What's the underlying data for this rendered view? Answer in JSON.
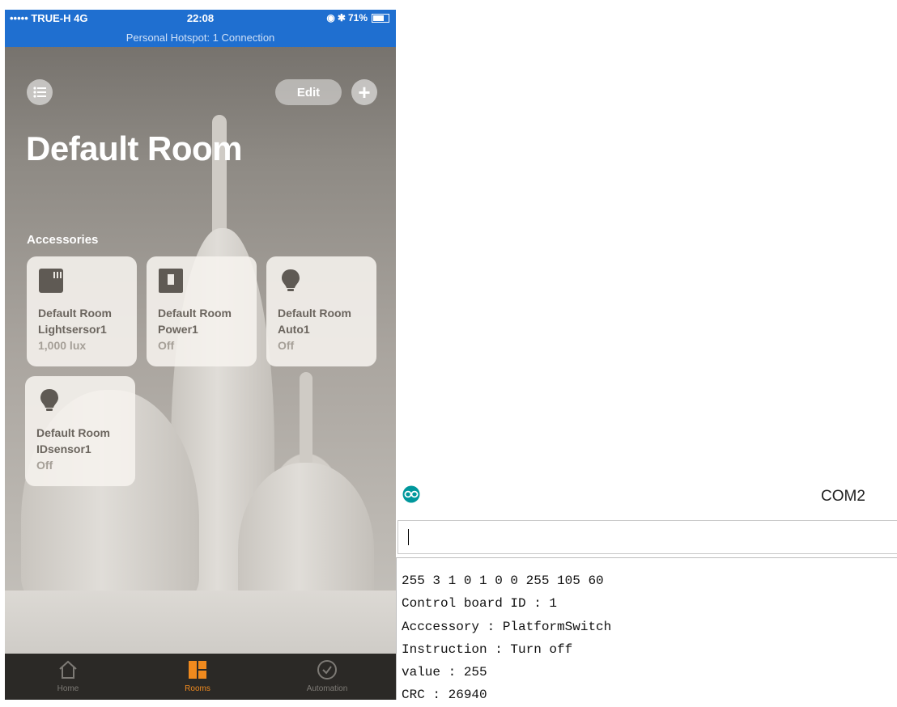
{
  "status_bar": {
    "carrier": "••••• TRUE-H  4G",
    "time": "22:08",
    "battery": "71%",
    "hotspot": "Personal Hotspot: 1 Connection"
  },
  "header": {
    "edit_label": "Edit",
    "add_label": "+",
    "room_title": "Default Room"
  },
  "accessories": {
    "section_label": "Accessories",
    "tiles": [
      {
        "name_line1": "Default Room",
        "name_line2": "Lightsersor1",
        "state": "1,000 lux",
        "icon": "light-sensor-icon"
      },
      {
        "name_line1": "Default Room",
        "name_line2": "Power1",
        "state": "Off",
        "icon": "power-switch-icon"
      },
      {
        "name_line1": "Default Room",
        "name_line2": "Auto1",
        "state": "Off",
        "icon": "bulb-icon"
      },
      {
        "name_line1": "Default Room",
        "name_line2": "IDsensor1",
        "state": "Off",
        "icon": "bulb-icon"
      }
    ]
  },
  "tabbar": {
    "tabs": [
      {
        "label": "Home",
        "icon": "home-icon",
        "active": false
      },
      {
        "label": "Rooms",
        "icon": "rooms-icon",
        "active": true
      },
      {
        "label": "Automation",
        "icon": "clock-icon",
        "active": false
      }
    ],
    "active_color": "#f08a1e"
  },
  "serial_monitor": {
    "title": "COM2",
    "input_value": "",
    "lines": [
      "255 3 1 0 1 0 0 255 105 60",
      "Control board ID : 1",
      "Acccessory : PlatformSwitch",
      "Instruction : Turn off",
      "value : 255",
      "CRC : 26940"
    ]
  }
}
